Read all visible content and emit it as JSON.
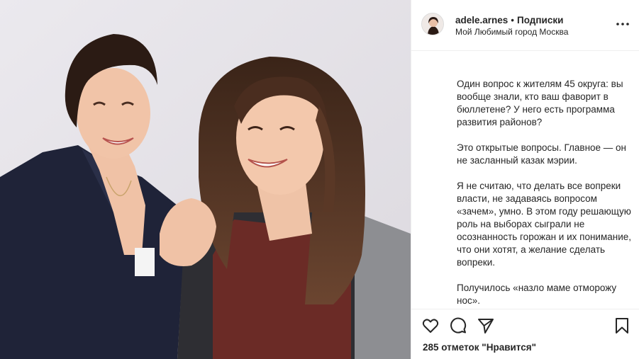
{
  "post": {
    "username": "adele.arnes",
    "separator": "•",
    "follow_label": "Подписки",
    "location": "Мой Любимый город Москва",
    "more_icon": "more-horizontal-icon"
  },
  "caption": {
    "paragraphs": [
      "Один вопрос к жителям 45 округа: вы вообще знали, кто ваш фаворит в бюллетене? У него есть программа развития районов?",
      "Это открытые вопросы. Главное — он не засланный казак мэрии.",
      "Я не считаю, что делать все вопреки власти, не задаваясь вопросом «зачем», умно. В этом году решающую роль на выборах сыграли не осознанность горожан и их понимание, что они хотят, а желание сделать вопреки.",
      "Получилось «назло маме отморожу нос»."
    ]
  },
  "actions": {
    "icons": [
      "heart-icon",
      "comment-icon",
      "share-icon",
      "bookmark-icon"
    ],
    "likes_text": "285 отметок \"Нравится\""
  },
  "colors": {
    "text": "#262626",
    "border": "#efefef",
    "photo_background": "#e7e5e9"
  }
}
